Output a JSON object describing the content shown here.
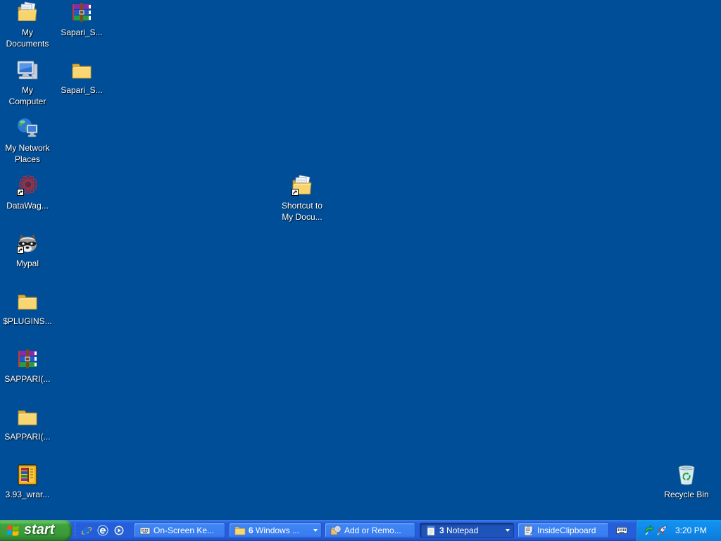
{
  "colors": {
    "desktop_background": "#004e98",
    "taskbar": "#245edb",
    "start_button": "#3c9a3c",
    "taskbar_button": "#3c81f3",
    "taskbar_button_active": "#1e52b7",
    "tray": "#0f87e8"
  },
  "desktop": {
    "icons": [
      {
        "icon": "my-documents-icon",
        "lines": [
          "My",
          "Documents"
        ]
      },
      {
        "icon": "my-computer-icon",
        "lines": [
          "My",
          "Computer"
        ]
      },
      {
        "icon": "my-network-places-icon",
        "lines": [
          "My Network",
          "Places"
        ]
      },
      {
        "icon": "datawag-icon",
        "shortcut": true,
        "lines": [
          "DataWag..."
        ]
      },
      {
        "icon": "mypal-raccoon-icon",
        "shortcut": true,
        "lines": [
          "Mypal"
        ]
      },
      {
        "icon": "folder-icon",
        "lines": [
          "$PLUGINS..."
        ]
      },
      {
        "icon": "winrar-archive-icon",
        "lines": [
          "SAPPARI(..."
        ]
      },
      {
        "icon": "folder-icon",
        "lines": [
          "SAPPARI(..."
        ]
      },
      {
        "icon": "winrar-installer-icon",
        "lines": [
          "3.93_wrar..."
        ]
      },
      {
        "icon": "winrar-archive-icon",
        "lines": [
          "Sapari_S..."
        ]
      },
      {
        "icon": "folder-icon",
        "lines": [
          "Sapari_S..."
        ]
      },
      {
        "icon": "my-documents-icon",
        "shortcut": true,
        "lines": [
          "Shortcut to",
          "My Docu..."
        ]
      },
      {
        "icon": "recycle-bin-icon",
        "lines": [
          "Recycle Bin"
        ]
      }
    ]
  },
  "taskbar": {
    "start_label": "start",
    "start_icon": "windows-logo-icon",
    "quick_launch": [
      {
        "icon": "internet-explorer-icon"
      },
      {
        "icon": "browser-icon"
      },
      {
        "icon": "media-player-icon"
      }
    ],
    "buttons": [
      {
        "icon": "on-screen-keyboard-icon",
        "label": "On-Screen Ke...",
        "grouped": false,
        "active": false
      },
      {
        "icon": "folder-icon",
        "count": "6",
        "label": "Windows ...",
        "grouped": true,
        "active": false
      },
      {
        "icon": "add-remove-programs-icon",
        "label": "Add or Remo...",
        "grouped": false,
        "active": false
      },
      {
        "icon": "notepad-icon",
        "count": "3",
        "label": "Notepad",
        "grouped": true,
        "active": true
      },
      {
        "icon": "insideclipboard-icon",
        "label": "InsideClipboard",
        "grouped": false,
        "active": false
      }
    ],
    "language_bar_icon": "keyboard-icon",
    "tray": {
      "icons": [
        "green-arrow-icon",
        "rocket-icon"
      ],
      "clock": "3:20 PM"
    }
  }
}
